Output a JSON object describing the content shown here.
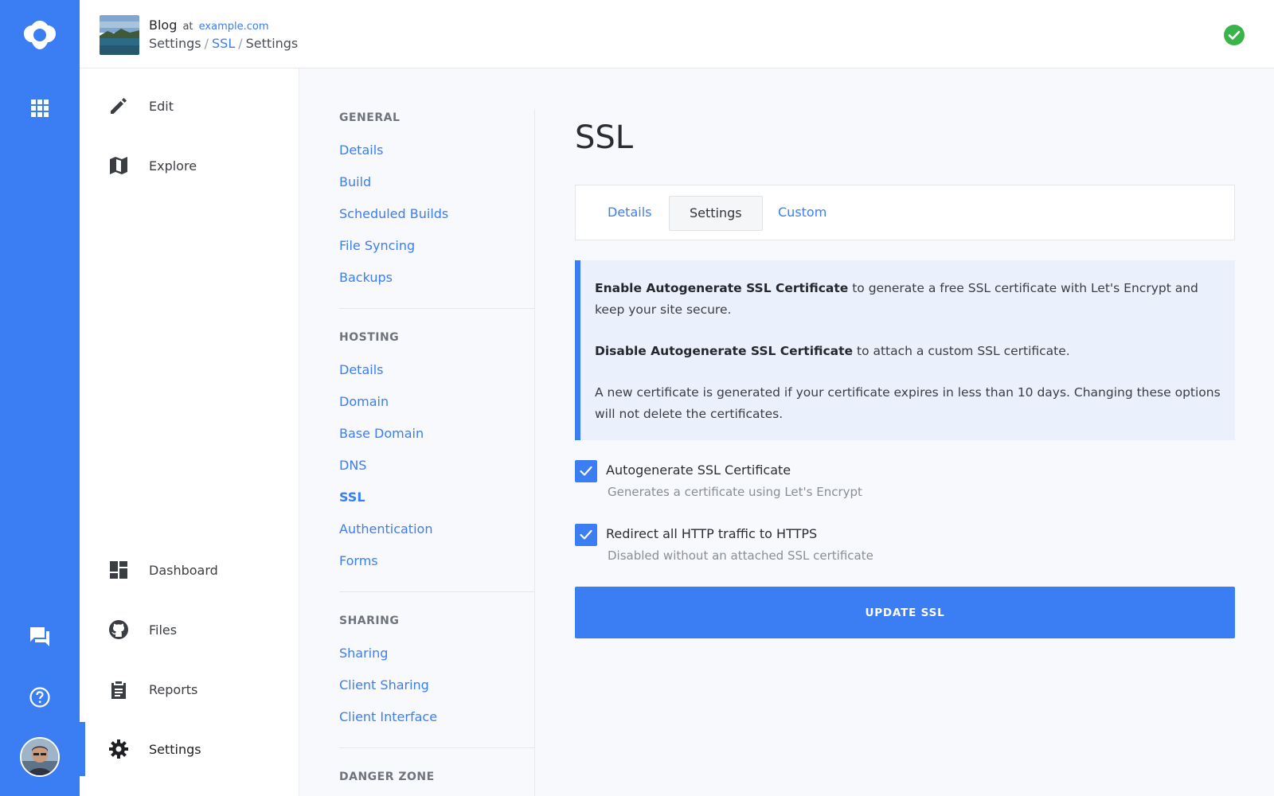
{
  "rail": {
    "logo_icon": "app-logo",
    "apps_icon": "grid-icon",
    "chat_icon": "chat-icon",
    "help_icon": "help-icon",
    "avatar": "user-avatar"
  },
  "header": {
    "site_name": "Blog",
    "at_label": "at",
    "domain": "example.com",
    "breadcrumb": [
      "Settings",
      "SSL",
      "Settings"
    ],
    "status_icon": "check-circle-icon",
    "status_color": "#3ab44a"
  },
  "main_nav": {
    "top": [
      {
        "label": "Edit",
        "icon": "pencil-icon"
      },
      {
        "label": "Explore",
        "icon": "map-icon"
      }
    ],
    "bottom": [
      {
        "label": "Dashboard",
        "icon": "dashboard-icon"
      },
      {
        "label": "Files",
        "icon": "github-icon"
      },
      {
        "label": "Reports",
        "icon": "clipboard-icon"
      },
      {
        "label": "Settings",
        "icon": "gear-icon",
        "active": true
      }
    ]
  },
  "sub_nav": {
    "sections": [
      {
        "title": "GENERAL",
        "items": [
          "Details",
          "Build",
          "Scheduled Builds",
          "File Syncing",
          "Backups"
        ]
      },
      {
        "title": "HOSTING",
        "items": [
          "Details",
          "Domain",
          "Base Domain",
          "DNS",
          "SSL",
          "Authentication",
          "Forms"
        ],
        "active": "SSL"
      },
      {
        "title": "SHARING",
        "items": [
          "Sharing",
          "Client Sharing",
          "Client Interface"
        ]
      },
      {
        "title": "DANGER ZONE",
        "items": []
      }
    ]
  },
  "content": {
    "title": "SSL",
    "tabs": [
      "Details",
      "Settings",
      "Custom"
    ],
    "active_tab": "Settings",
    "info": {
      "p1_bold": "Enable Autogenerate SSL Certificate",
      "p1_rest": " to generate a free SSL certificate with Let's Encrypt and keep your site secure.",
      "p2_bold": "Disable Autogenerate SSL Certificate",
      "p2_rest": " to attach a custom SSL certificate.",
      "p3": "A new certificate is generated if your certificate expires in less than 10 days. Changing these options will not delete the certificates."
    },
    "options": [
      {
        "label": "Autogenerate SSL Certificate",
        "help": "Generates a certificate using Let's Encrypt",
        "checked": true
      },
      {
        "label": "Redirect all HTTP traffic to HTTPS",
        "help": "Disabled without an attached SSL certificate",
        "checked": true
      }
    ],
    "button": "UPDATE SSL"
  },
  "colors": {
    "accent": "#3b7ef3",
    "info_bg": "#eaf1fd"
  }
}
